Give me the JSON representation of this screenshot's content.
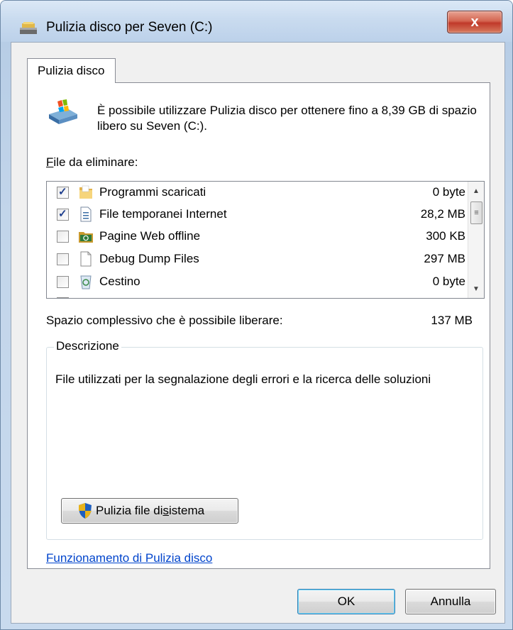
{
  "window": {
    "title": "Pulizia disco per Seven (C:)",
    "close_label": "x"
  },
  "tab": {
    "label": "Pulizia disco"
  },
  "intro": {
    "text": "È possibile utilizzare Pulizia disco per ottenere fino a 8,39 GB di spazio libero su Seven (C:)."
  },
  "files": {
    "label_first": "F",
    "label_rest": "ile da eliminare:",
    "items": [
      {
        "name": "Programmi scaricati",
        "size": "0 byte",
        "checked": true,
        "icon": "folder-icon"
      },
      {
        "name": "File temporanei Internet",
        "size": "28,2 MB",
        "checked": true,
        "icon": "document-icon"
      },
      {
        "name": "Pagine Web offline",
        "size": "300 KB",
        "checked": false,
        "icon": "offline-folder-icon"
      },
      {
        "name": "Debug Dump Files",
        "size": "297 MB",
        "checked": false,
        "icon": "blank-file-icon"
      },
      {
        "name": "Cestino",
        "size": "0 byte",
        "checked": false,
        "icon": "recycle-bin-icon"
      }
    ]
  },
  "total": {
    "label": "Spazio complessivo che è possibile liberare:",
    "value": "137 MB"
  },
  "description": {
    "title": "Descrizione",
    "text": "File utilizzati per la segnalazione degli errori e la ricerca delle soluzioni"
  },
  "system_button": {
    "label_pre": "Pulizia file di ",
    "label_u": "s",
    "label_post": "istema"
  },
  "help_link": {
    "label": "Funzionamento di Pulizia disco"
  },
  "buttons": {
    "ok": "OK",
    "cancel": "Annulla"
  }
}
